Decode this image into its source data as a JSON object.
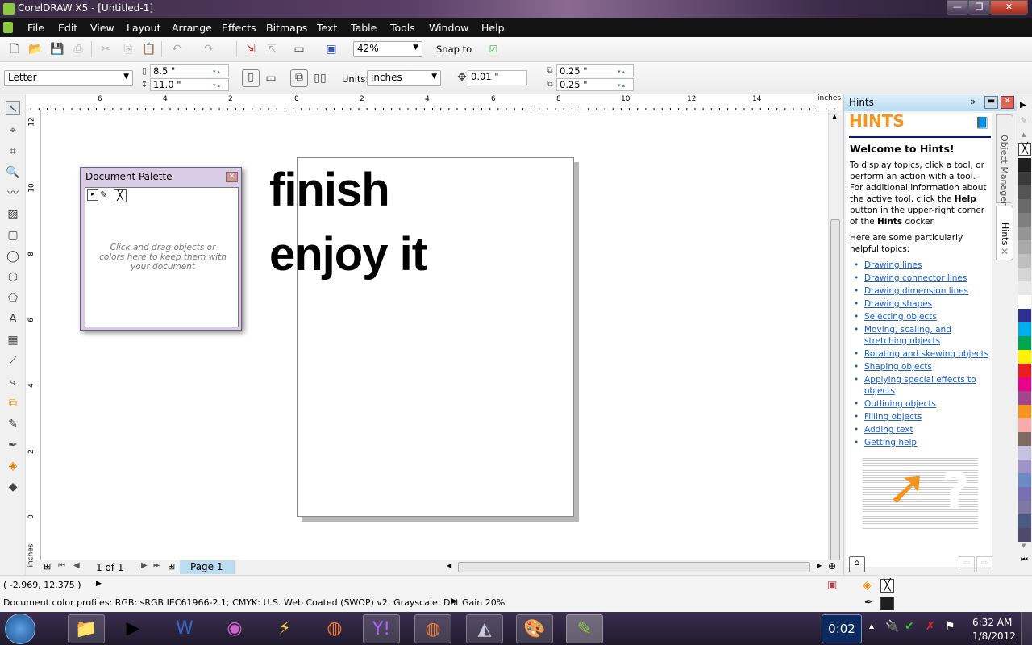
{
  "window": {
    "title": "CorelDRAW X5 - [Untitled-1]",
    "min": "—",
    "max": "❐",
    "close": "✕"
  },
  "menu": [
    "File",
    "Edit",
    "View",
    "Layout",
    "Arrange",
    "Effects",
    "Bitmaps",
    "Text",
    "Table",
    "Tools",
    "Window",
    "Help"
  ],
  "toolbar": {
    "zoom": "42%",
    "snap": "Snap to"
  },
  "propbar": {
    "paper": "Letter",
    "width": "8.5 \"",
    "height": "11.0 \"",
    "units_label": "Units:",
    "units": "inches",
    "nudge": "0.01 \"",
    "dup_x": "0.25 \"",
    "dup_y": "0.25 \""
  },
  "rulers": {
    "unit": "inches",
    "h_labels": [
      "6",
      "4",
      "2",
      "0",
      "2",
      "4",
      "6",
      "8",
      "10",
      "12",
      "14"
    ],
    "v_labels": [
      "12",
      "10",
      "8",
      "6",
      "4",
      "2",
      "0"
    ]
  },
  "canvas": {
    "line1": "finish",
    "line2": "enjoy it"
  },
  "doc_palette": {
    "title": "Document Palette",
    "hint": "Click and drag objects or colors here to keep them with your document"
  },
  "pages": {
    "counter": "1 of 1",
    "tab": "Page 1"
  },
  "status": {
    "coords": "( -2.969, 12.375 )",
    "profiles": "Document color profiles: RGB: sRGB IEC61966-2.1; CMYK: U.S. Web Coated (SWOP) v2; Grayscale: Dot Gain 20%"
  },
  "hints": {
    "title": "Hints",
    "heading": "HINTS",
    "welcome": "Welcome to Hints!",
    "intro_a": "To display topics, click a tool, or perform an action with a tool. For additional information about the active tool, click the ",
    "help": "Help",
    "intro_b": " button in the upper-right corner of the ",
    "hints": "Hints",
    "intro_c": " docker.",
    "topics_intro": "Here are some particularly helpful topics:",
    "links": [
      "Drawing lines",
      "Drawing connector lines",
      "Drawing dimension lines",
      "Drawing shapes",
      "Selecting objects",
      "Moving, scaling, and stretching objects",
      "Rotating and skewing objects",
      "Shaping objects",
      "Applying special effects to objects",
      "Outlining objects",
      "Filling objects",
      "Adding text",
      "Getting help"
    ],
    "tab_object_manager": "Object Manager",
    "tab_hints": "Hints"
  },
  "palette": [
    "#1e1e1e",
    "#3a3a3a",
    "#545454",
    "#696969",
    "#7f7f7f",
    "#959595",
    "#aaaaaa",
    "#bfbfbf",
    "#d5d5d5",
    "#e9e9e9",
    "#ffffff",
    "#2e3192",
    "#00aeef",
    "#00a651",
    "#fff200",
    "#ed1c24",
    "#ec008c",
    "#a3478c",
    "#f7941d",
    "#f9aaaa",
    "#7f6a63",
    "#c5c2e0",
    "#9e94c8",
    "#6b8ac6",
    "#7870b3",
    "#7e78a4",
    "#4b5a85",
    "#4f4a6d"
  ],
  "fill_outline": {
    "outline_color": "#1e1e1e"
  },
  "taskbar": {
    "timer": "0:02",
    "time": "6:32 AM",
    "date": "1/8/2012"
  }
}
